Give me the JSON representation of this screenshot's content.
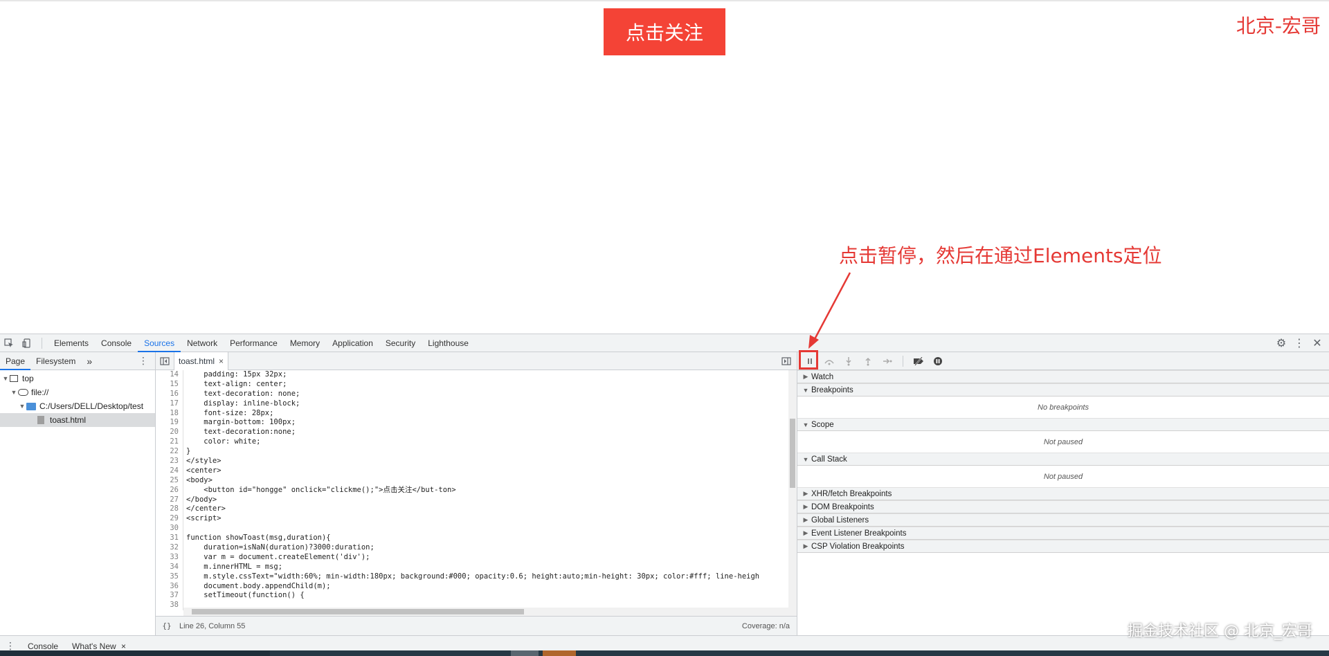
{
  "page": {
    "button_label": "点击关注",
    "corner_text": "北京-宏哥",
    "annotation": "点击暂停，然后在通过Elements定位",
    "watermark": "掘金技术社区 @ 北京_宏哥"
  },
  "devtools": {
    "tabs": [
      "Elements",
      "Console",
      "Sources",
      "Network",
      "Performance",
      "Memory",
      "Application",
      "Security",
      "Lighthouse"
    ],
    "active_tab": "Sources",
    "navigator": {
      "tabs": [
        "Page",
        "Filesystem"
      ],
      "more": "»",
      "tree": [
        "top",
        "file://",
        "C:/Users/DELL/Desktop/test",
        "toast.html"
      ]
    },
    "editor": {
      "file_tab": "toast.html",
      "close": "×",
      "status_position": "Line 26, Column 55",
      "status_coverage": "Coverage: n/a",
      "format_icon": "{}",
      "lines": [
        {
          "n": "14",
          "t": "    padding: 15px 32px;"
        },
        {
          "n": "15",
          "t": "    text-align: center;"
        },
        {
          "n": "16",
          "t": "    text-decoration: none;"
        },
        {
          "n": "17",
          "t": "    display: inline-block;"
        },
        {
          "n": "18",
          "t": "    font-size: 28px;"
        },
        {
          "n": "19",
          "t": "    margin-bottom: 100px;"
        },
        {
          "n": "20",
          "t": "    text-decoration:none;"
        },
        {
          "n": "21",
          "t": "    color: white;"
        },
        {
          "n": "22",
          "t": "}"
        },
        {
          "n": "23",
          "t": "</style>"
        },
        {
          "n": "24",
          "t": "<center>"
        },
        {
          "n": "25",
          "t": "<body>"
        },
        {
          "n": "26",
          "t": "    <button id=\"hongge\" onclick=\"clickme();\">点击关注</but-ton>"
        },
        {
          "n": "27",
          "t": "</body>"
        },
        {
          "n": "28",
          "t": "</center>"
        },
        {
          "n": "29",
          "t": "<script>"
        },
        {
          "n": "30",
          "t": ""
        },
        {
          "n": "31",
          "t": "function showToast(msg,duration){"
        },
        {
          "n": "32",
          "t": "    duration=isNaN(duration)?3000:duration;"
        },
        {
          "n": "33",
          "t": "    var m = document.createElement('div');"
        },
        {
          "n": "34",
          "t": "    m.innerHTML = msg;"
        },
        {
          "n": "35",
          "t": "    m.style.cssText=\"width:60%; min-width:180px; background:#000; opacity:0.6; height:auto;min-height: 30px; color:#fff; line-heigh"
        },
        {
          "n": "36",
          "t": "    document.body.appendChild(m);"
        },
        {
          "n": "37",
          "t": "    setTimeout(function() {"
        },
        {
          "n": "38",
          "t": ""
        }
      ]
    },
    "debugger": {
      "panes": [
        {
          "title": "Watch",
          "expanded": false,
          "body": ""
        },
        {
          "title": "Breakpoints",
          "expanded": true,
          "body": "No breakpoints"
        },
        {
          "title": "Scope",
          "expanded": true,
          "body": "Not paused"
        },
        {
          "title": "Call Stack",
          "expanded": true,
          "body": "Not paused"
        },
        {
          "title": "XHR/fetch Breakpoints",
          "expanded": false,
          "body": ""
        },
        {
          "title": "DOM Breakpoints",
          "expanded": false,
          "body": ""
        },
        {
          "title": "Global Listeners",
          "expanded": false,
          "body": ""
        },
        {
          "title": "Event Listener Breakpoints",
          "expanded": false,
          "body": ""
        },
        {
          "title": "CSP Violation Breakpoints",
          "expanded": false,
          "body": ""
        }
      ]
    },
    "drawer": {
      "tabs": [
        "Console",
        "What's New"
      ],
      "active": "What's New",
      "close": "×"
    }
  },
  "colors": {
    "accent_red": "#f44336",
    "annotation_red": "#e53935",
    "devtools_blue": "#1a73e8"
  }
}
